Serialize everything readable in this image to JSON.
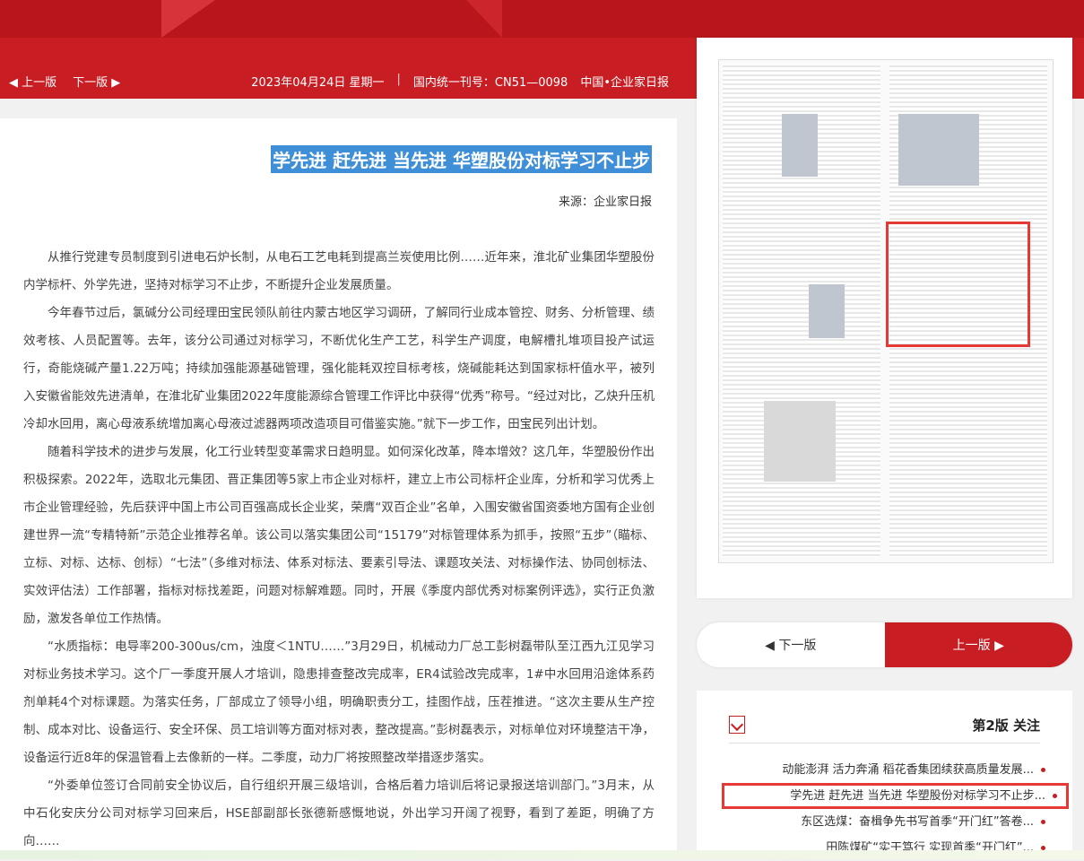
{
  "header": {
    "prev_page": "◀ 上一版",
    "next_page": "下一版 ▶",
    "date": "2023年04月24日 星期一",
    "separator": "|",
    "cn_code": "国内统一刊号：CN51—0098",
    "paper_name": "中国•企业家日报"
  },
  "article": {
    "title": "学先进 赶先进 当先进 华塑股份对标学习不止步",
    "source": "来源：企业家日报",
    "paragraphs": [
      "从推行党建专员制度到引进电石炉长制，从电石工艺电耗到提高兰炭使用比例……近年来，淮北矿业集团华塑股份内学标杆、外学先进，坚持对标学习不止步，不断提升企业发展质量。",
      "今年春节过后，氯碱分公司经理田宝民领队前往内蒙古地区学习调研，了解同行业成本管控、财务、分析管理、绩效考核、人员配置等。去年，该分公司通过对标学习，不断优化生产工艺，科学生产调度，电解槽扎堆项目投产试运行，奇能烧碱产量1.22万吨；持续加强能源基础管理，强化能耗双控目标考核，烧碱能耗达到国家标杆值水平，被列入安徽省能效先进清单，在淮北矿业集团2022年度能源综合管理工作评比中获得“优秀”称号。“经过对比，乙炔升压机冷却水回用，离心母液系统增加离心母液过滤器两项改造项目可借鉴实施。”就下一步工作，田宝民列出计划。",
      "随着科学技术的进步与发展，化工行业转型变革需求日趋明显。如何深化改革，降本增效？这几年，华塑股份作出积极探索。2022年，选取北元集团、晋正集团等5家上市企业对标杆，建立上市公司标杆企业库，分析和学习优秀上市企业管理经验，先后获评中国上市公司百强高成长企业奖，荣膺“双百企业”名单，入围安徽省国资委地方国有企业创建世界一流“专精特新”示范企业推荐名单。该公司以落实集团公司“15179”对标管理体系为抓手，按照“五步”（瞄标、立标、对标、达标、创标）“七法”（多维对标法、体系对标法、要素引导法、课题攻关法、对标操作法、协同创标法、实效评估法）工作部署，指标对标找差距，问题对标解难题。同时，开展《季度内部优秀对标案例评选》，实行正负激励，激发各单位工作热情。",
      "“水质指标：电导率200-300us/cm，浊度＜1NTU……”3月29日，机械动力厂总工彭树磊带队至江西九江见学习对标业务技术学习。这个厂一季度开展人才培训，隐患排查整改完成率，ER4试验改完成率，1#中水回用沿途体系药剂单耗4个对标课题。为落实任务，厂部成立了领导小组，明确职责分工，挂图作战，压茬推进。“这次主要从生产控制、成本对比、设备运行、安全环保、员工培训等方面对标对表，整改提高。”彭树磊表示，对标单位对环境整洁干净，设备运行近8年的保温管看上去像新的一样。二季度，动力厂将按照整改举措逐步落实。",
      "“外委单位签订合同前安全协议后，自行组织开展三级培训，合格后着力培训后将记录报送培训部门。”3月末，从中石化安庆分公司对标学习回来后，HSE部副部长张德新感慨地说，外出学习开阔了视野，看到了差距，明确了方向……"
    ]
  },
  "right": {
    "prev_button": "上一版 ▶",
    "next_button": "◀ 下一版",
    "section_title": "第2版 关注",
    "items": [
      "动能澎湃 活力奔涌 稻花香集团续获高质量发展...",
      "学先进 赶先进 当先进 华塑股份对标学习不止步...",
      "东区选煤：奋楫争先书写首季“开门红”答卷...",
      "田陈煤矿“实干笃行 实现首季“开门红”..."
    ]
  },
  "colors": {
    "brand": "#c71d23",
    "highlight": "#e53935",
    "selection": "#3f8fd8"
  }
}
